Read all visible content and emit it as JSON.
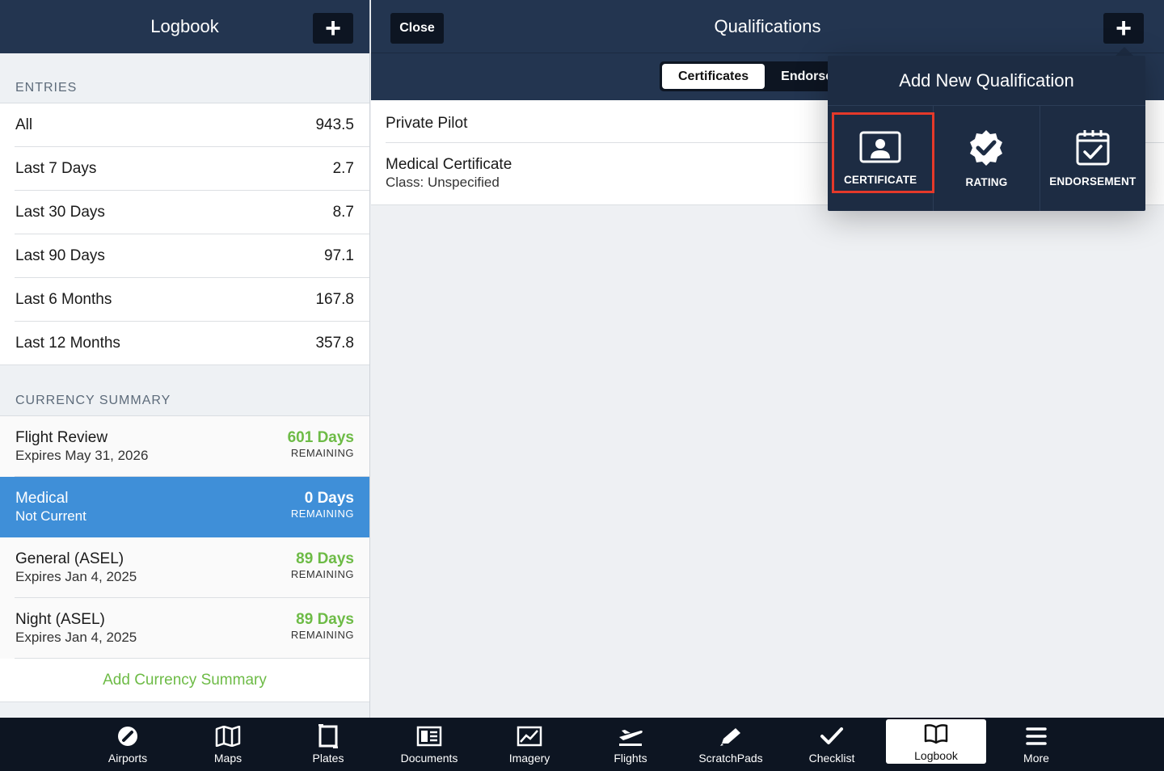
{
  "left": {
    "title": "Logbook",
    "add_label": "+",
    "entries_header": "ENTRIES",
    "entries": [
      {
        "label": "All",
        "value": "943.5"
      },
      {
        "label": "Last 7 Days",
        "value": "2.7"
      },
      {
        "label": "Last 30 Days",
        "value": "8.7"
      },
      {
        "label": "Last 90 Days",
        "value": "97.1"
      },
      {
        "label": "Last 6 Months",
        "value": "167.8"
      },
      {
        "label": "Last 12 Months",
        "value": "357.8"
      }
    ],
    "currency_header": "CURRENCY SUMMARY",
    "currency": [
      {
        "name": "Flight Review",
        "sub": "Expires May 31, 2026",
        "days": "601 Days",
        "remaining": "REMAINING"
      },
      {
        "name": "Medical",
        "sub": "Not Current",
        "days": "0 Days",
        "remaining": "REMAINING"
      },
      {
        "name": "General (ASEL)",
        "sub": "Expires Jan 4, 2025",
        "days": "89 Days",
        "remaining": "REMAINING"
      },
      {
        "name": "Night (ASEL)",
        "sub": "Expires Jan 4, 2025",
        "days": "89 Days",
        "remaining": "REMAINING"
      }
    ],
    "add_currency": "Add Currency Summary"
  },
  "right": {
    "title": "Qualifications",
    "close_label": "Close",
    "add_label": "+",
    "segments": [
      "Certificates",
      "Endorse"
    ],
    "items": [
      {
        "title": "Private Pilot"
      },
      {
        "title": "Medical Certificate",
        "sub": "Class: Unspecified"
      }
    ]
  },
  "popover": {
    "title": "Add New Qualification",
    "options": [
      {
        "label": "CERTIFICATE",
        "icon": "certificate-icon"
      },
      {
        "label": "RATING",
        "icon": "rating-badge-icon"
      },
      {
        "label": "ENDORSEMENT",
        "icon": "calendar-check-icon"
      }
    ]
  },
  "tabbar": {
    "tabs": [
      {
        "label": "Airports",
        "icon": "airport-icon"
      },
      {
        "label": "Maps",
        "icon": "map-icon"
      },
      {
        "label": "Plates",
        "icon": "plate-icon"
      },
      {
        "label": "Documents",
        "icon": "documents-icon"
      },
      {
        "label": "Imagery",
        "icon": "imagery-icon"
      },
      {
        "label": "Flights",
        "icon": "flights-icon"
      },
      {
        "label": "ScratchPads",
        "icon": "pencil-icon"
      },
      {
        "label": "Checklist",
        "icon": "checkmark-icon"
      },
      {
        "label": "Logbook",
        "icon": "book-icon"
      },
      {
        "label": "More",
        "icon": "menu-icon"
      }
    ],
    "active": "Logbook"
  },
  "colors": {
    "header_bg": "#233550",
    "button_bg": "#0d1522",
    "selected_row": "#3f8fd8",
    "days_green": "#6dbb46",
    "highlight_red": "#e5392a"
  }
}
